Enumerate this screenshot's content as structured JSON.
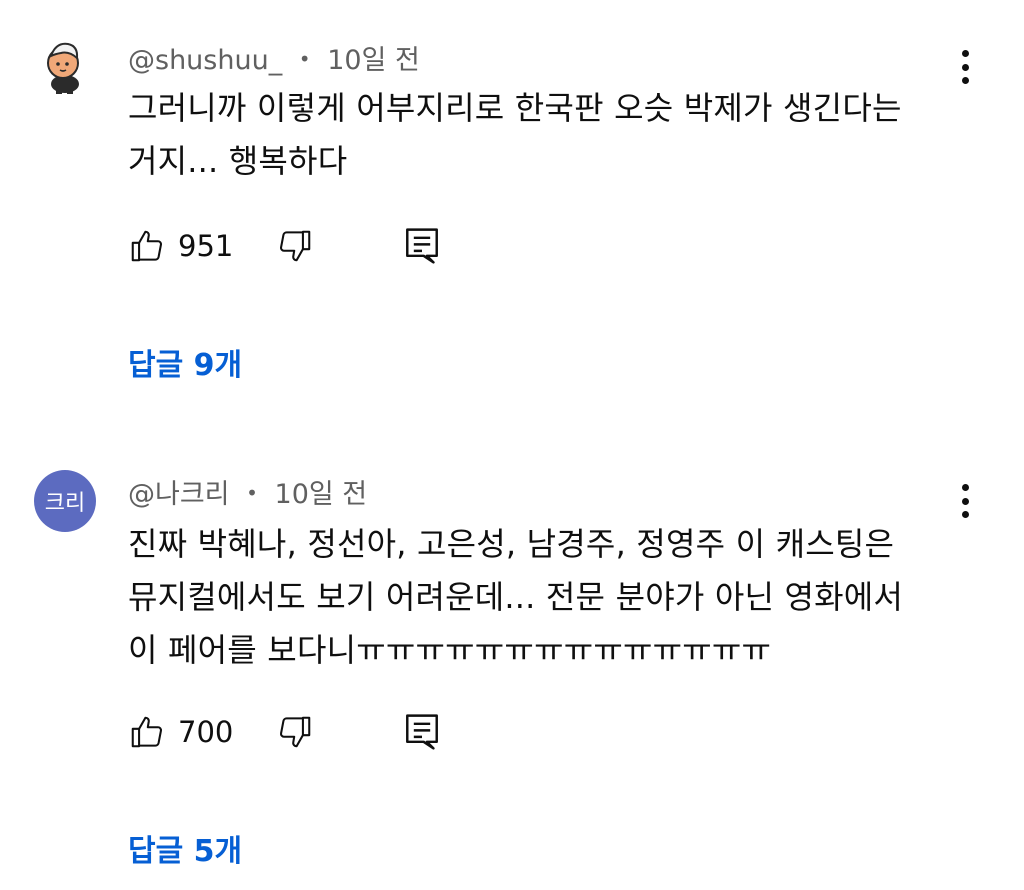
{
  "comments": [
    {
      "author": "@shushuu_",
      "separator": "•",
      "time": "10일 전",
      "text": "그러니까 이렇게 어부지리로 한국판 오슷 박제가 생긴다는\n거지... 행복하다",
      "likes": "951",
      "replies_label": "답글 9개",
      "avatar_type": "cartoon-character"
    },
    {
      "author": "@나크리",
      "separator": "•",
      "time": "10일 전",
      "text": "진짜 박혜나, 정선아, 고은성, 남경주, 정영주 이 캐스팅은\n뮤지컬에서도 보기 어려운데... 전문 분야가 아닌 영화에서\n이 페어를 보다니ㅠㅠㅠㅠㅠㅠㅠㅠㅠㅠㅠㅠㅠㅠ",
      "likes": "700",
      "replies_label": "답글 5개",
      "avatar_text": "크리",
      "avatar_color": "#5c6bc0"
    }
  ],
  "icons": {
    "like": "thumb-up-icon",
    "dislike": "thumb-down-icon",
    "reply": "comment-icon",
    "more": "more-vertical-icon"
  },
  "colors": {
    "link": "#065fd4",
    "meta": "#606060",
    "text": "#0f0f0f"
  }
}
